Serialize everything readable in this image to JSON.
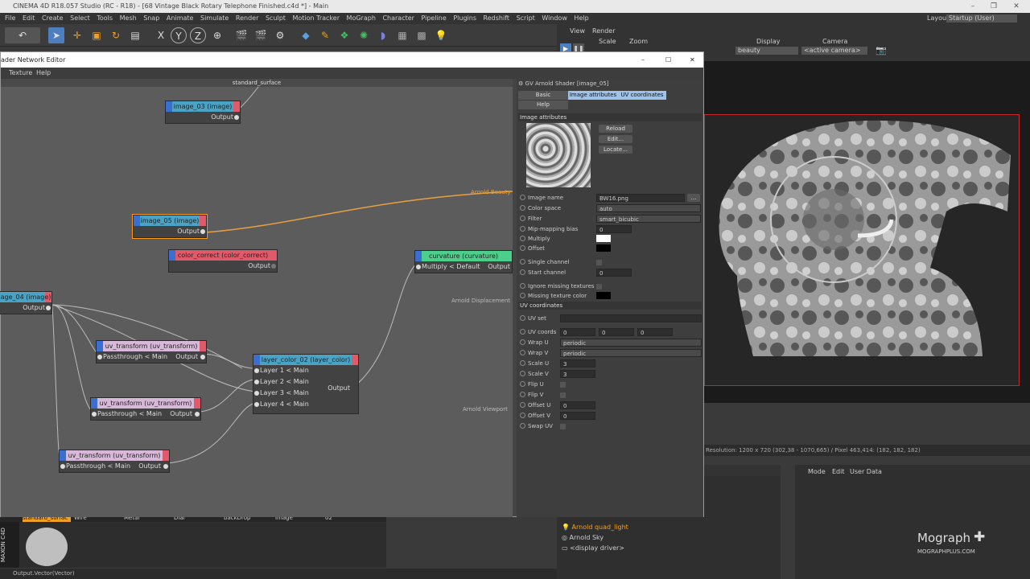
{
  "titlebar": {
    "title": "CINEMA 4D R18.057 Studio (RC - R18) - [68 Vintage Black Rotary Telephone Finished.c4d *] - Main"
  },
  "menubar": [
    "File",
    "Edit",
    "Create",
    "Select",
    "Tools",
    "Mesh",
    "Snap",
    "Animate",
    "Simulate",
    "Render",
    "Sculpt",
    "Motion Tracker",
    "MoGraph",
    "Character",
    "Pipeline",
    "Plugins",
    "Redshift",
    "Script",
    "Window",
    "Help"
  ],
  "layout": {
    "label": "Layout:",
    "value": "Startup (User)"
  },
  "viewport_panel": {
    "view": "View",
    "render": "Render",
    "scale": "Scale",
    "zoom": "Zoom",
    "display_label": "Display",
    "display_value": "beauty",
    "camera_label": "Camera",
    "camera_value": "<active camera>"
  },
  "render_status": "Resolution: 1200 x 720 (302,38 - 1070,665) / Pixel 463,414: (182, 182, 182)",
  "sne": {
    "title": "ader Network Editor",
    "menu": [
      "Texture",
      "Help"
    ],
    "graph_title": "standard_surface"
  },
  "nodes": {
    "image_03": {
      "title": "image_03 (image)",
      "out": "Output"
    },
    "image_05": {
      "title": "image_05 (image)",
      "out": "Output"
    },
    "color_correct": {
      "title": "color_correct (color_correct)",
      "out": "Output"
    },
    "curvature": {
      "title": "curvature (curvature)",
      "in": "Multiply < Default",
      "out": "Output"
    },
    "image_04": {
      "title": "age_04 (image)",
      "out": "Output"
    },
    "uvt1": {
      "title": "uv_transform (uv_transform)",
      "in": "Passthrough < Main",
      "out": "Output"
    },
    "uvt2": {
      "title": "uv_transform (uv_transform)",
      "in": "Passthrough < Main",
      "out": "Output"
    },
    "uvt3": {
      "title": "uv_transform (uv_transform)",
      "in": "Passthrough < Main",
      "out": "Output"
    },
    "layer_color": {
      "title": "layer_color_02 (layer_color)",
      "l1": "Layer 1 < Main",
      "l2": "Layer 2 < Main",
      "l3": "Layer 3 < Main",
      "l4": "Layer 4 < Main",
      "out": "Output"
    }
  },
  "graph_labels": {
    "beauty": "Arnold Beauty",
    "displacement": "Arnold Displacement",
    "viewport": "Arnold Viewport"
  },
  "attr": {
    "header": "GV Arnold Shader [image_05]",
    "tabs": [
      "Basic",
      "Image attributes",
      "UV coordinates",
      "Help"
    ],
    "section1": "Image attributes",
    "reload": "Reload",
    "edit": "Edit...",
    "locate": "Locate...",
    "image_name_label": "Image name",
    "image_name": "BW16.png",
    "browse": "...",
    "color_space_label": "Color space",
    "color_space": "auto",
    "filter_label": "Filter",
    "filter": "smart_bicubic",
    "mip_label": "Mip-mapping bias",
    "mip": "0",
    "multiply_label": "Multiply",
    "offset_label": "Offset",
    "single_channel_label": "Single channel",
    "start_channel_label": "Start channel",
    "start_channel": "0",
    "ignore_label": "Ignore missing textures",
    "missing_color_label": "Missing texture color",
    "section2": "UV coordinates",
    "uvset_label": "UV set",
    "uvcoords_label": "UV coords",
    "uv0": "0",
    "uv1": "0",
    "uv2": "0",
    "wrapu_label": "Wrap U",
    "wrapu": "periodic",
    "wrapv_label": "Wrap V",
    "wrapv": "periodic",
    "scaleu_label": "Scale U",
    "scaleu": "3",
    "scalev_label": "Scale V",
    "scalev": "3",
    "flipu_label": "Flip U",
    "flipv_label": "Flip V",
    "offu_label": "Offset U",
    "offu": "0",
    "offv_label": "Offset V",
    "offv": "0",
    "swap_label": "Swap UV"
  },
  "materials": [
    "standard_surfac",
    "Wire",
    "Metal",
    "Dial",
    "backDrop",
    "Image",
    "02"
  ],
  "objects": [
    "Arnold quad_light",
    "Arnold Sky",
    "<display driver>"
  ],
  "attr_mgr": [
    "Mode",
    "Edit",
    "User Data"
  ],
  "watermark": {
    "line1": "Mograph",
    "line2": "MOGRAPHPLUS.COM"
  },
  "statusbar": "Output.Vector(Vector)",
  "colors": {
    "node_image": "#4aa3c4",
    "node_red": "#e05a6a",
    "node_green": "#4ccf8a",
    "node_uv": "#d8b8d8",
    "wire": "#e8a040"
  }
}
